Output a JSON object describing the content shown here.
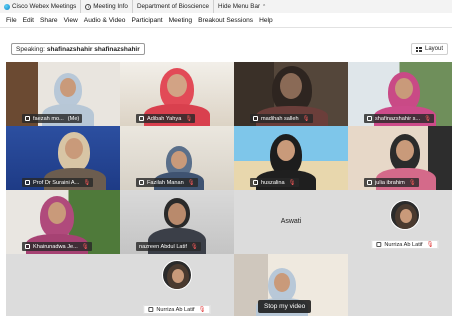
{
  "titlebar": {
    "app_label": "Cisco Webex Meetings",
    "meeting_info": "Meeting Info",
    "department": "Department of Bioscience",
    "hide_menu": "Hide Menu Bar"
  },
  "menu": [
    "File",
    "Edit",
    "Share",
    "View",
    "Audio & Video",
    "Participant",
    "Meeting",
    "Breakout Sessions",
    "Help"
  ],
  "speaking": {
    "label": "Speaking:",
    "names": "shafinazshahir shafinazshahir"
  },
  "layout_button": "Layout",
  "participants": [
    {
      "name": "faezah mo...",
      "extra": "(Me)"
    },
    {
      "name": "Adibah Yahya"
    },
    {
      "name": "madihah salleh"
    },
    {
      "name": "shafinazshahir s..."
    },
    {
      "name": "Prof Dr Suraini A..."
    },
    {
      "name": "Fazilah Manan"
    },
    {
      "name": "huszalina"
    },
    {
      "name": "julia ibrahim"
    },
    {
      "name": "Khairunadwa Je..."
    },
    {
      "name": "nazreen Abdul Latif"
    },
    {
      "name": "Aswati"
    },
    {
      "name": "Nurriza Ab Latif"
    },
    {
      "name": "Nurriza Ab Latif"
    }
  ],
  "stop_video": "Stop my video",
  "colors": {
    "active_border": "#39b54a",
    "mute": "#e03b3b"
  }
}
